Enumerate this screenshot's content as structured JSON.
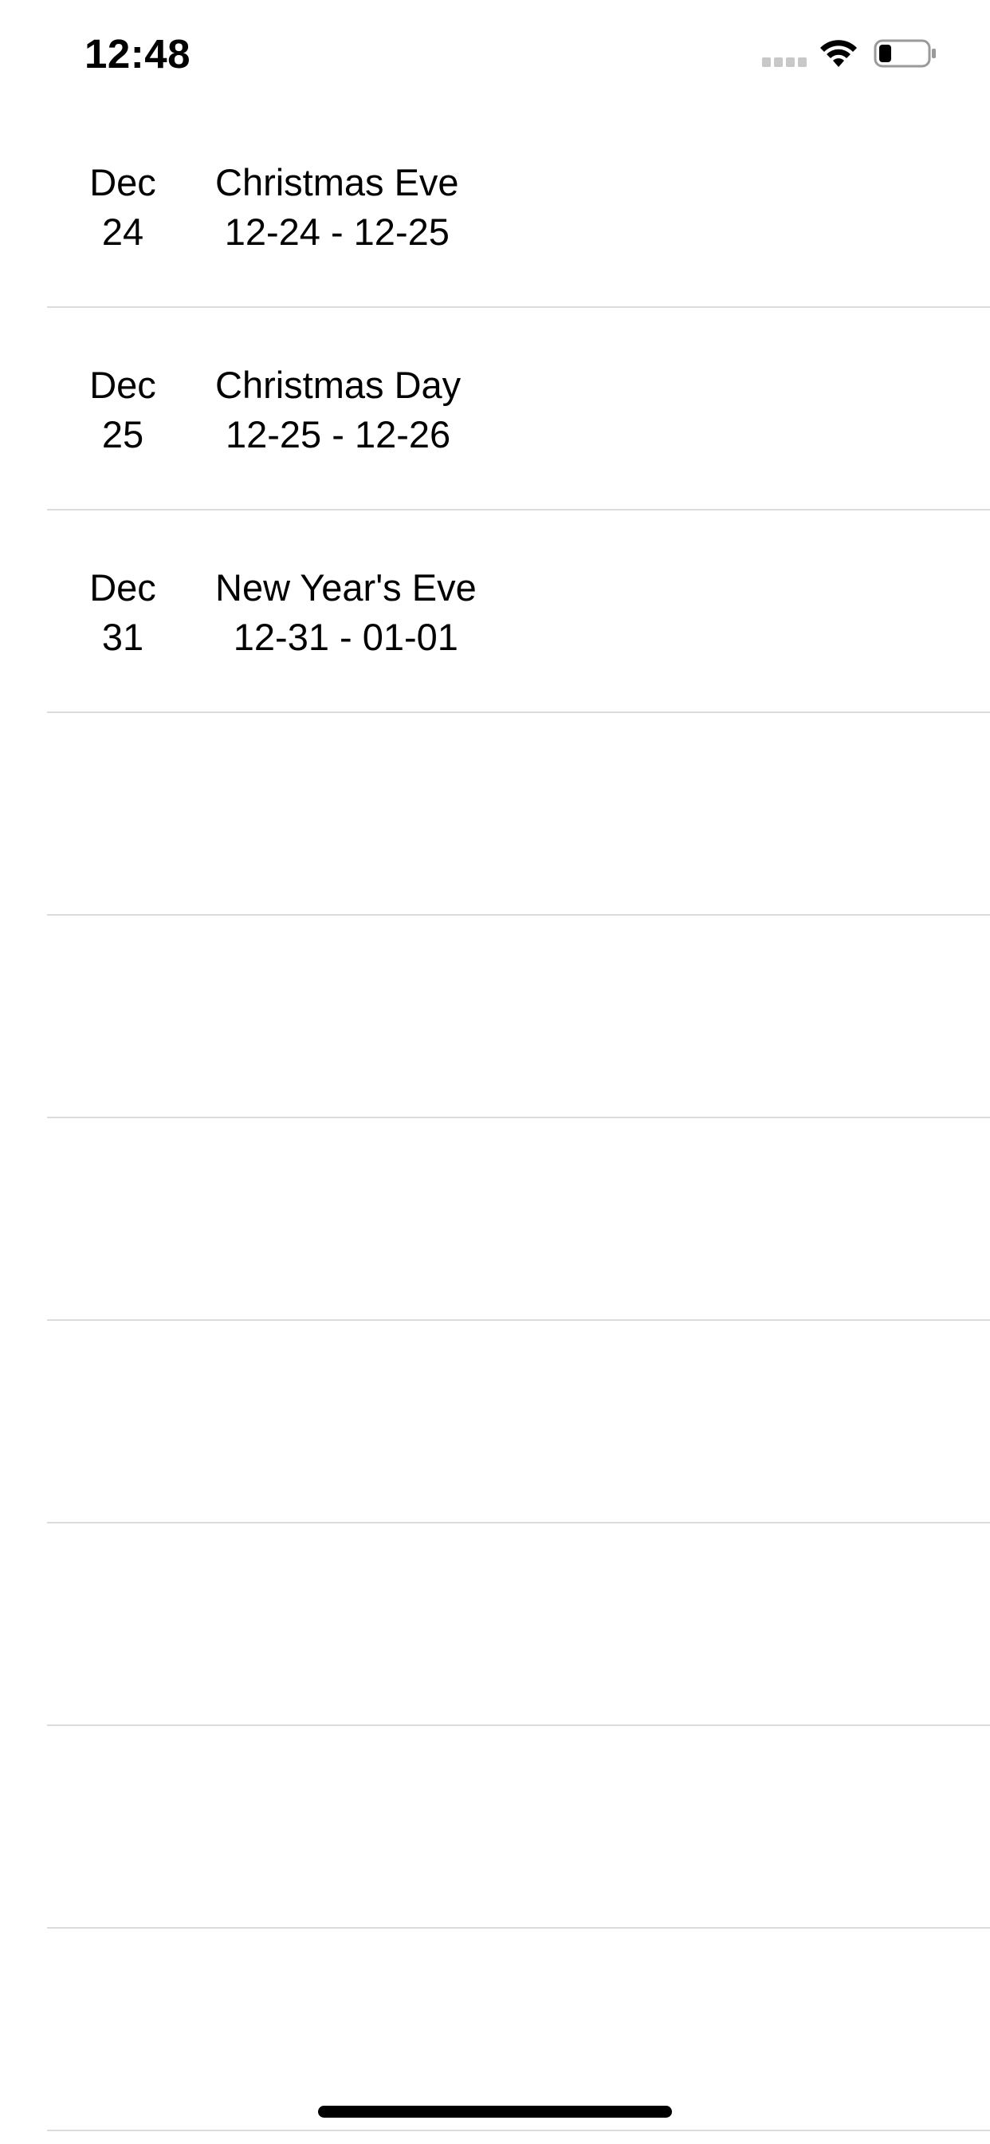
{
  "status_bar": {
    "time": "12:48",
    "signal_icon": "cellular-signal-icon",
    "wifi_icon": "wifi-icon",
    "battery_icon": "battery-icon",
    "battery_level": 0.25
  },
  "events": [
    {
      "month": "Dec",
      "day": "24",
      "title": "Christmas Eve",
      "range": "12-24 - 12-25"
    },
    {
      "month": "Dec",
      "day": "25",
      "title": "Christmas Day",
      "range": "12-25 - 12-26"
    },
    {
      "month": "Dec",
      "day": "31",
      "title": "New Year's Eve",
      "range": "12-31 - 01-01"
    }
  ],
  "empty_rows": 7,
  "colors": {
    "separator": "#dcdcdf",
    "text": "#000000",
    "background": "#ffffff"
  }
}
